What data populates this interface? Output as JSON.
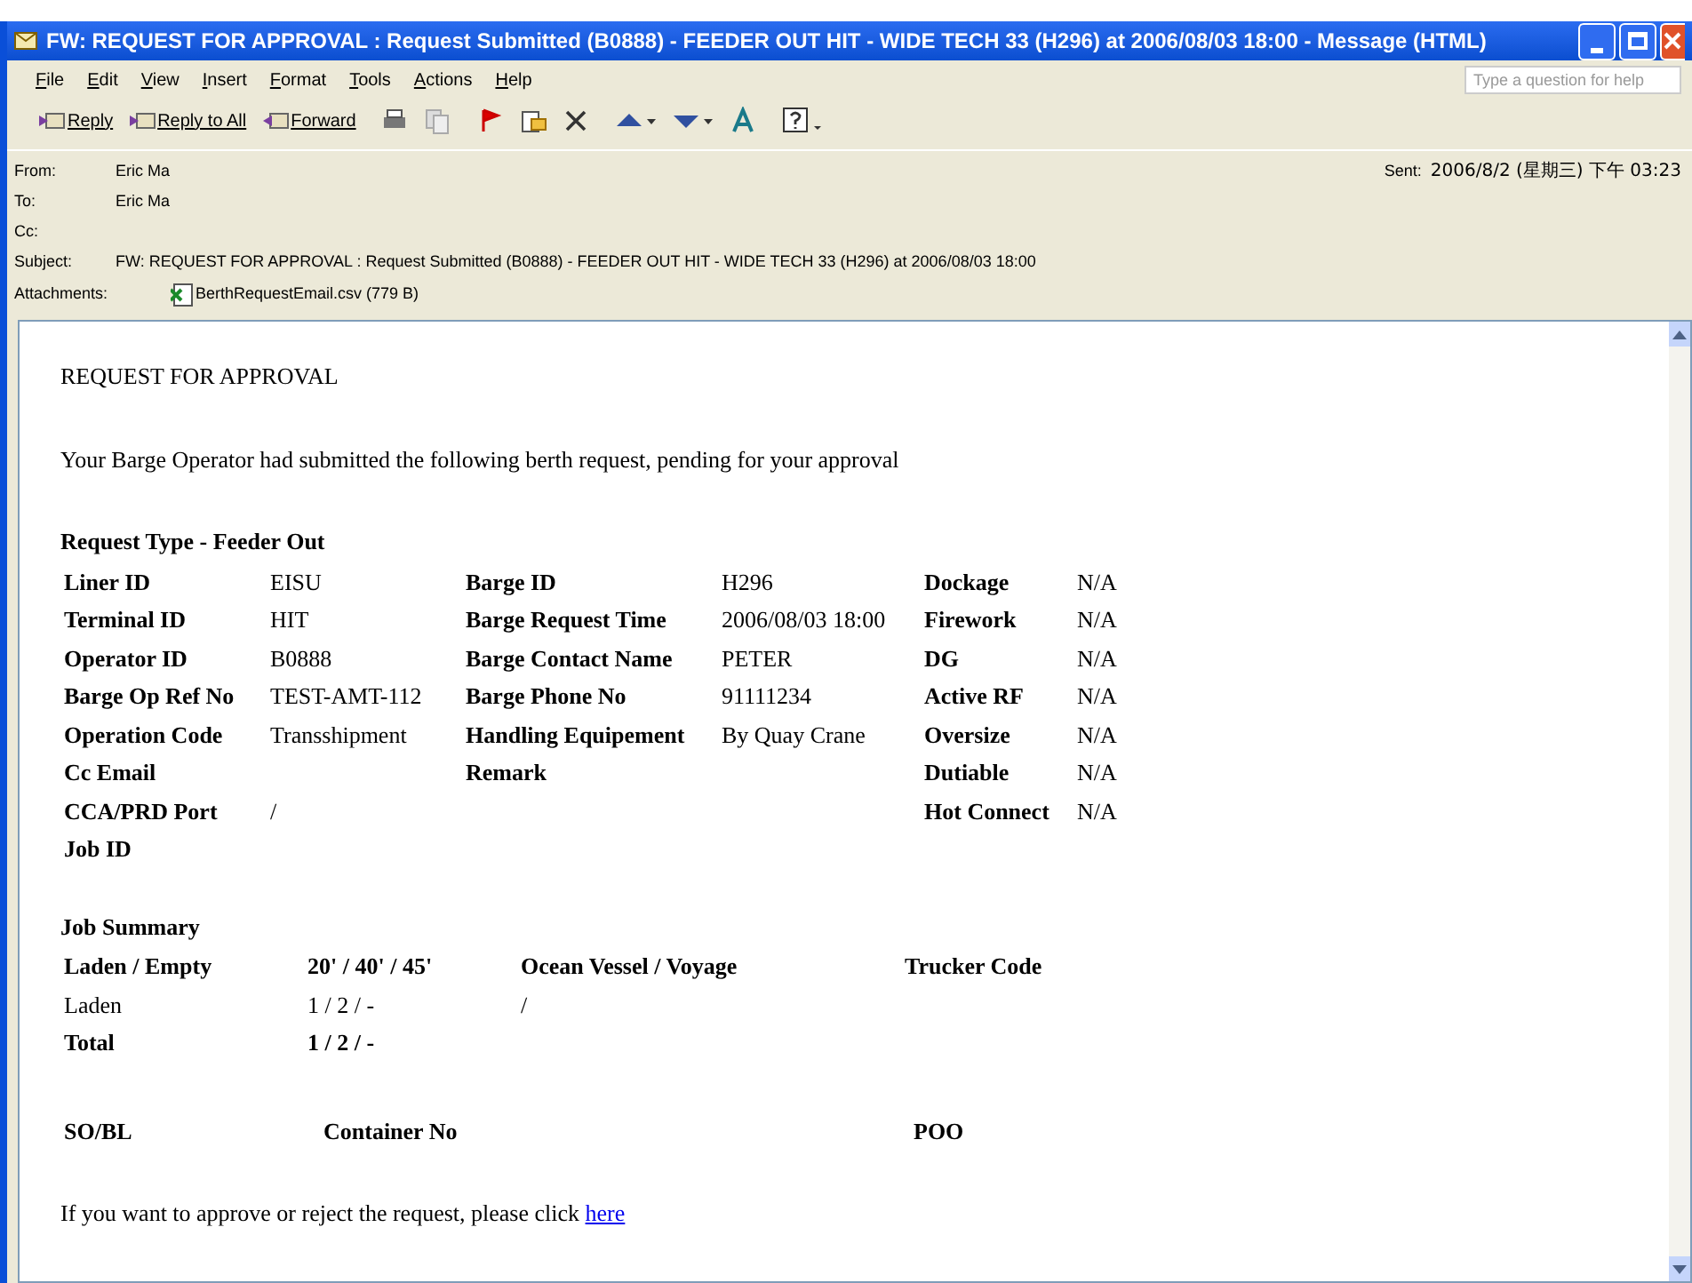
{
  "window": {
    "title": "FW: REQUEST FOR APPROVAL : Request Submitted (B0888) - FEEDER OUT HIT - WIDE TECH 33 (H296) at 2006/08/03 18:00 - Message (HTML)"
  },
  "menu": [
    "File",
    "Edit",
    "View",
    "Insert",
    "Format",
    "Tools",
    "Actions",
    "Help"
  ],
  "help_box": {
    "placeholder": "Type a question for help"
  },
  "toolbar": [
    {
      "kind": "reply",
      "label": "Reply"
    },
    {
      "kind": "reply_all",
      "label": "Reply to All"
    },
    {
      "kind": "forward",
      "label": "Forward"
    },
    {
      "kind": "print"
    },
    {
      "kind": "copy"
    },
    {
      "kind": "flag"
    },
    {
      "kind": "move"
    },
    {
      "kind": "delete"
    },
    {
      "kind": "up"
    },
    {
      "kind": "down"
    },
    {
      "kind": "address"
    },
    {
      "kind": "help"
    }
  ],
  "header": {
    "fields": [
      {
        "label": "From:",
        "value": "Eric Ma"
      },
      {
        "label": "To:",
        "value": "Eric Ma"
      },
      {
        "label": "Cc:"
      },
      {
        "label": "Subject:",
        "value": "FW: REQUEST FOR APPROVAL : Request Submitted (B0888) - FEEDER OUT HIT - WIDE TECH 33 (H296) at 2006/08/03 18:00"
      }
    ],
    "sent": {
      "label": "Sent:",
      "value": "2006/8/2 (星期三) 下午 03:23"
    },
    "attachments": {
      "label": "Attachments:",
      "file": "BerthRequestEmail.csv (779 B)"
    }
  },
  "body": {
    "title": "REQUEST FOR APPROVAL",
    "intro": "Your Barge Operator had submitted the following berth request, pending for your approval",
    "request_type": "Request Type - Feeder Out",
    "request_rows": [
      [
        {
          "label": "Liner ID",
          "value": "EISU"
        },
        {
          "label": "Barge ID",
          "value": "H296"
        },
        {
          "label": "Dockage",
          "value": "N/A"
        }
      ],
      [
        {
          "label": "Terminal ID",
          "value": "HIT"
        },
        {
          "label": "Barge Request Time",
          "value": "2006/08/03 18:00"
        },
        {
          "label": "Firework",
          "value": "N/A"
        }
      ],
      [
        {
          "label": "Operator ID",
          "value": "B0888"
        },
        {
          "label": "Barge Contact Name",
          "value": "PETER"
        },
        {
          "label": "DG",
          "value": "N/A"
        }
      ],
      [
        {
          "label": "Barge Op Ref No",
          "value": "TEST-AMT-112"
        },
        {
          "label": "Barge Phone No",
          "value": "91111234"
        },
        {
          "label": "Active RF",
          "value": "N/A"
        }
      ],
      [
        {
          "label": "Operation Code",
          "value": "Transshipment"
        },
        {
          "label": "Handling Equipement",
          "value": "By Quay Crane"
        },
        {
          "label": "Oversize",
          "value": "N/A"
        }
      ],
      [
        {
          "label": "Cc Email"
        },
        {
          "label": "Remark"
        },
        {
          "label": "Dutiable",
          "value": "N/A"
        }
      ],
      [
        {
          "label": "CCA/PRD Port",
          "value": "/"
        },
        {},
        {
          "label": "Hot Connect",
          "value": "N/A"
        }
      ],
      [
        {
          "label": "Job ID"
        },
        {},
        {}
      ]
    ],
    "job_summary": {
      "title": "Job Summary",
      "columns": [
        "Laden / Empty",
        "20' / 40' / 45'",
        "Ocean Vessel / Voyage",
        "Trucker Code"
      ],
      "rows": [
        {
          "kind": "data",
          "cells": [
            "Laden",
            "1 / 2 / -",
            "/"
          ]
        },
        {
          "kind": "total",
          "cells": [
            "Total",
            "1 / 2 / -"
          ]
        }
      ]
    },
    "container_columns": [
      "SO/BL",
      "Container No",
      "POO"
    ],
    "footer": {
      "text": "If you want to approve or reject the request, please click",
      "link": "here"
    }
  }
}
